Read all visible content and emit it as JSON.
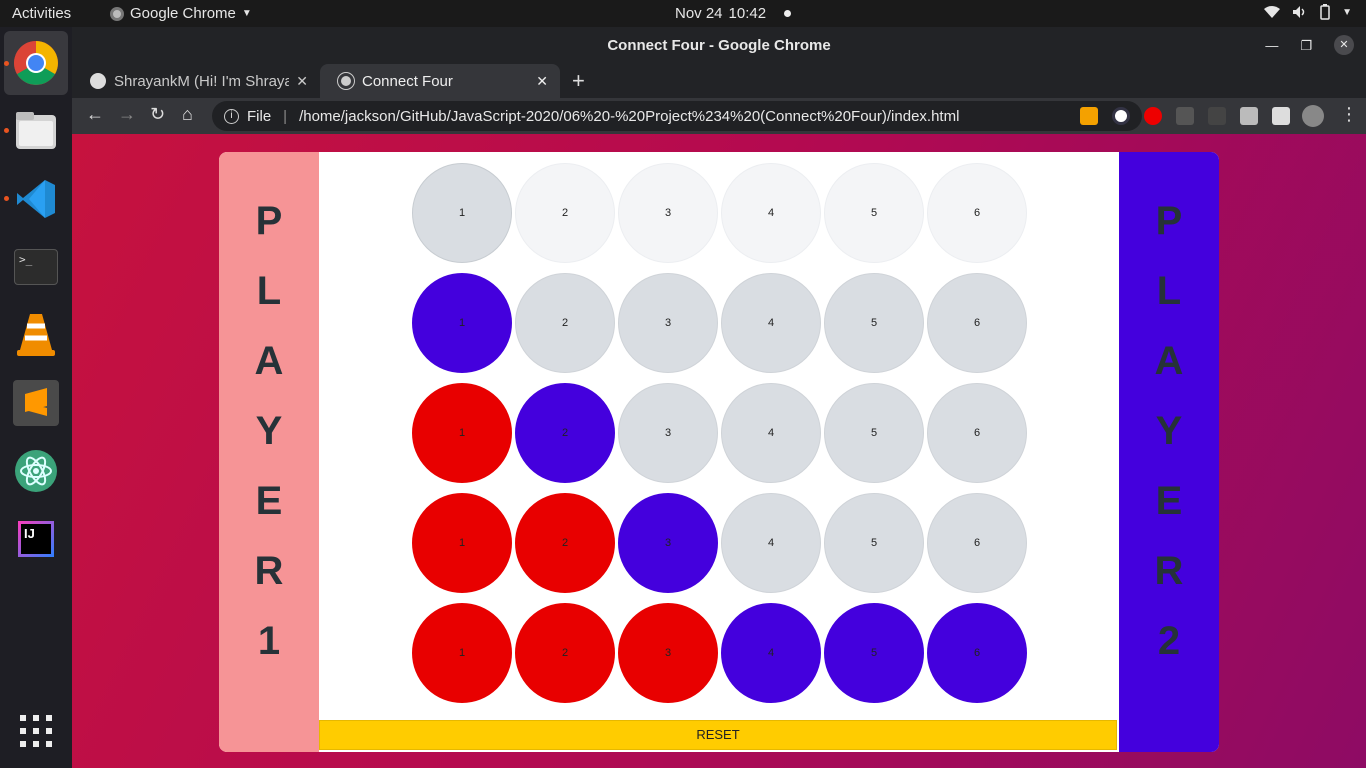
{
  "topbar": {
    "activities": "Activities",
    "app_name": "Google Chrome",
    "date": "Nov 24",
    "time": "10:42"
  },
  "dock": {
    "items": [
      "chrome-icon",
      "files-icon",
      "vscode-icon",
      "terminal-icon",
      "vlc-icon",
      "sublime-icon",
      "atom-icon",
      "intellij-icon"
    ],
    "terminal_glyph": ">_",
    "intellij_glyph": "IJ"
  },
  "window": {
    "title": "Connect Four - Google Chrome",
    "tabs": [
      {
        "label": "ShrayankM (Hi! I'm Shraya"
      },
      {
        "label": "Connect Four"
      }
    ],
    "omnibox": {
      "scheme": "File",
      "url": "/home/jackson/GitHub/JavaScript-2020/06%20-%20Project%234%20(Connect%20Four)/index.html"
    }
  },
  "game": {
    "player1": [
      "P",
      "L",
      "A",
      "Y",
      "E",
      "R",
      "1"
    ],
    "player2": [
      "P",
      "L",
      "A",
      "Y",
      "E",
      "R",
      "2"
    ],
    "colors": {
      "player1": "#e80000",
      "player2": "#4400dd",
      "panel1": "#f69496",
      "reset": "#ffcc00"
    },
    "rows": [
      [
        "top-hover",
        "top",
        "top",
        "top",
        "top",
        "top"
      ],
      [
        "blue",
        "empty",
        "empty",
        "empty",
        "empty",
        "empty"
      ],
      [
        "red",
        "blue",
        "empty",
        "empty",
        "empty",
        "empty"
      ],
      [
        "red",
        "red",
        "blue",
        "empty",
        "empty",
        "empty"
      ],
      [
        "red",
        "red",
        "red",
        "blue",
        "blue",
        "blue"
      ]
    ],
    "column_labels": [
      "1",
      "2",
      "3",
      "4",
      "5",
      "6"
    ],
    "reset_label": "RESET"
  }
}
